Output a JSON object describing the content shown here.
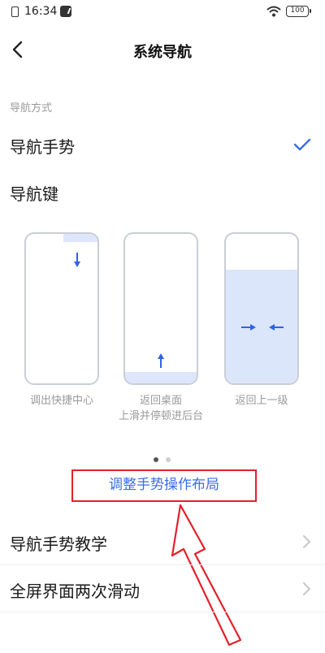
{
  "status_bar": {
    "time": "16:34",
    "battery": "100"
  },
  "header": {
    "title": "系统导航"
  },
  "section": {
    "label": "导航方式"
  },
  "options": [
    {
      "label": "导航手势",
      "selected": true
    },
    {
      "label": "导航键",
      "selected": false
    }
  ],
  "illustrations": [
    {
      "caption": "调出快捷中心",
      "sub_caption": ""
    },
    {
      "caption": "返回桌面",
      "sub_caption": "上滑并停顿进后台"
    },
    {
      "caption": "返回上一级",
      "sub_caption": ""
    }
  ],
  "pager": {
    "total": 2,
    "current": 1
  },
  "adjust_link": {
    "label": "调整手势操作布局"
  },
  "list": [
    {
      "label": "导航手势教学"
    },
    {
      "label": "全屏界面两次滑动"
    }
  ],
  "colors": {
    "accent": "#3a6ee8",
    "highlight": "#e1212b",
    "muted": "#9a9a9a"
  }
}
